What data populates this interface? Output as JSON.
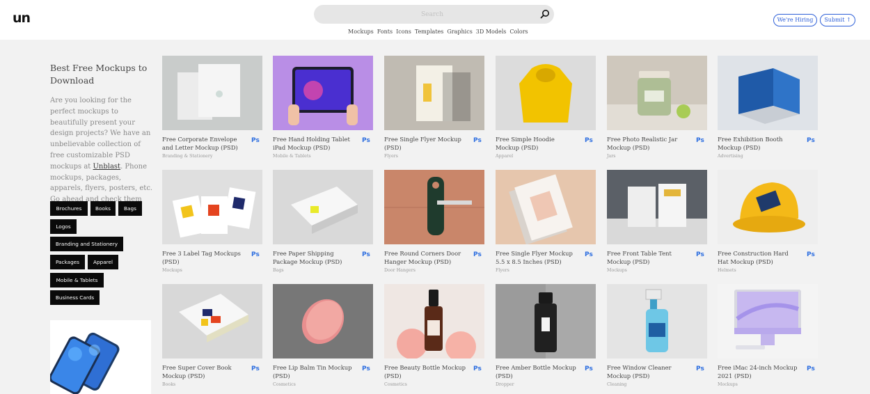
{
  "header": {
    "logo": "un",
    "search_placeholder": "Search",
    "nav": [
      "Mockups",
      "Fonts",
      "Icons",
      "Templates",
      "Graphics",
      "3D Models",
      "Colors"
    ],
    "hiring_label": "We're Hiring",
    "submit_label": "Submit ↑"
  },
  "sidebar": {
    "title": "Best Free Mockups to Download",
    "desc_before": "Are you looking for the perfect mockups to beautifully present your design projects? We have an unbelievable collection of free customizable PSD mockups at ",
    "desc_link": "Unblast",
    "desc_after": ". Phone mockups, packages, apparels, flyers, posters, etc. Go ahead and check them out.",
    "tags": [
      "Brochures",
      "Books",
      "Bags",
      "Logos",
      "Branding and Stationery",
      "Packages",
      "Apparel",
      "Mobile & Tablets",
      "Business Cards"
    ]
  },
  "badge": "Ps",
  "cards": [
    {
      "title": "Free Corporate Envelope and Letter Mockup (PSD)",
      "category": "Branding & Stationery",
      "bg": "#c9cccb"
    },
    {
      "title": "Free Hand Holding Tablet iPad Mockup (PSD)",
      "category": "Mobile & Tablets",
      "bg": "#b98ee6"
    },
    {
      "title": "Free Single Flyer Mockup (PSD)",
      "category": "Flyers",
      "bg": "#c9c4bc"
    },
    {
      "title": "Free Simple Hoodie Mockup (PSD)",
      "category": "Apparel",
      "bg": "#dcdcdc"
    },
    {
      "title": "Free Photo Realistic Jar Mockup (PSD)",
      "category": "Jars",
      "bg": "#cfc8bd"
    },
    {
      "title": "Free Exhibition Booth Mockup (PSD)",
      "category": "Advertising",
      "bg": "#dfe3e8"
    },
    {
      "title": "Free 3 Label Tag Mockups (PSD)",
      "category": "Mockups",
      "bg": "#dfdfdf"
    },
    {
      "title": "Free Paper Shipping Package Mockup (PSD)",
      "category": "Bags",
      "bg": "#d9d9d9"
    },
    {
      "title": "Free Round Corners Door Hanger Mockup (PSD)",
      "category": "Door Hangers",
      "bg": "#c9866a"
    },
    {
      "title": "Free Single Flyer Mockup 5.5 x 8.5 Inches (PSD)",
      "category": "Flyers",
      "bg": "#e6c6ad"
    },
    {
      "title": "Free Front Table Tent Mockup (PSD)",
      "category": "Mockups",
      "bg": "#5b6067"
    },
    {
      "title": "Free Construction Hard Hat Mockup (PSD)",
      "category": "Helmets",
      "bg": "#eeeeee"
    },
    {
      "title": "Free Super Cover Book Mockup (PSD)",
      "category": "Books",
      "bg": "#d8d8d8"
    },
    {
      "title": "Free Lip Balm Tin Mockup (PSD)",
      "category": "Cosmetics",
      "bg": "#6b6b6b"
    },
    {
      "title": "Free Beauty Bottle Mockup (PSD)",
      "category": "Cosmetics",
      "bg": "#efe7e3"
    },
    {
      "title": "Free Amber Bottle Mockup (PSD)",
      "category": "Dropper",
      "bg": "#a9a9a9"
    },
    {
      "title": "Free Window Cleaner Mockup (PSD)",
      "category": "Cleaning",
      "bg": "#e4e4e4"
    },
    {
      "title": "Free iMac 24-inch Mockup 2021 (PSD)",
      "category": "Mockups",
      "bg": "#f4f4f4"
    }
  ]
}
